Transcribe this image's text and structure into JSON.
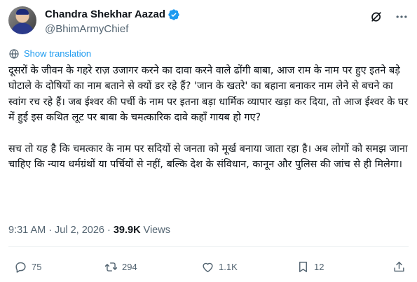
{
  "author": {
    "display_name": "Chandra Shekhar Aazad",
    "handle": "@BhimArmyChief"
  },
  "translate": {
    "label": "Show translation"
  },
  "tweet": {
    "paragraphs": [
      "दूसरों के जीवन के गहरे राज़ उजागर करने का दावा करने वाले ढोंगी बाबा, आज राम के नाम पर हुए इतने बड़े घोटाले के दोषियों का नाम बताने से क्यों डर रहे हैं? 'जान के खतरे' का बहाना बनाकर नाम लेने से बचने का स्वांग रच रहे हैं। जब ईश्वर की पर्ची के नाम पर इतना बड़ा धार्मिक व्यापार खड़ा कर दिया, तो आज ईश्वर के घर में हुई इस कथित लूट पर बाबा के चमत्कारिक दावे कहाँ गायब हो गए?",
      "सच तो यह है कि चमत्कार के नाम पर सदियों से जनता को मूर्ख बनाया जाता रहा है। अब लोगों को समझ जाना चाहिए कि न्याय धर्मग्रंथों या पर्चियों से नहीं, बल्कि देश के संविधान, कानून और पुलिस की जांच से ही मिलेगा।"
    ]
  },
  "meta": {
    "time": "9:31 AM",
    "separator": "·",
    "date": "Jul 2, 2026",
    "views_count": "39.9K",
    "views_label": "Views"
  },
  "actions": {
    "replies": "75",
    "reposts": "294",
    "likes": "1.1K",
    "bookmarks": "12"
  },
  "colors": {
    "accent": "#1d9bf0",
    "muted": "#536471",
    "text": "#0f1419"
  },
  "icons": [
    "verified-badge-icon",
    "grok-icon",
    "more-icon",
    "translate-icon",
    "reply-icon",
    "repost-icon",
    "like-icon",
    "bookmark-icon",
    "share-icon"
  ]
}
